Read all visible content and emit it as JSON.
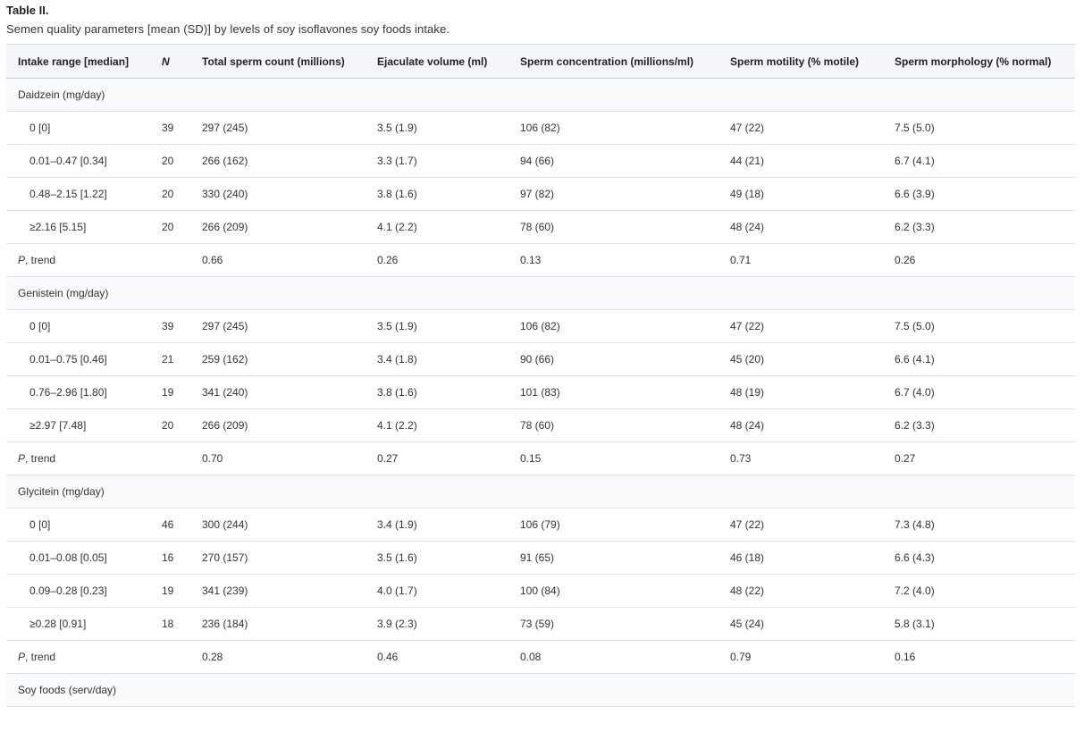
{
  "table_label": "Table II.",
  "caption": "Semen quality parameters [mean (SD)] by levels of soy isoflavones soy foods intake.",
  "columns": [
    "Intake range [median]",
    "N",
    "Total sperm count (millions)",
    "Ejaculate volume (ml)",
    "Sperm concentration (millions/ml)",
    "Sperm motility (% motile)",
    "Sperm morphology (% normal)"
  ],
  "groups": [
    {
      "label": "Daidzein (mg/day)",
      "rows": [
        [
          "0 [0]",
          "39",
          "297 (245)",
          "3.5 (1.9)",
          "106 (82)",
          "47 (22)",
          "7.5 (5.0)"
        ],
        [
          "0.01–0.47 [0.34]",
          "20",
          "266 (162)",
          "3.3 (1.7)",
          "94 (66)",
          "44 (21)",
          "6.7 (4.1)"
        ],
        [
          "0.48–2.15 [1.22]",
          "20",
          "330 (240)",
          "3.8 (1.6)",
          "97 (82)",
          "49 (18)",
          "6.6 (3.9)"
        ],
        [
          "≥2.16 [5.15]",
          "20",
          "266 (209)",
          "4.1 (2.2)",
          "78 (60)",
          "48 (24)",
          "6.2 (3.3)"
        ]
      ],
      "trend": {
        "p": "P",
        "label": ", trend",
        "values": [
          "0.66",
          "0.26",
          "0.13",
          "0.71",
          "0.26"
        ]
      }
    },
    {
      "label": "Genistein (mg/day)",
      "rows": [
        [
          "0 [0]",
          "39",
          "297 (245)",
          "3.5 (1.9)",
          "106 (82)",
          "47 (22)",
          "7.5 (5.0)"
        ],
        [
          "0.01–0.75 [0.46]",
          "21",
          "259 (162)",
          "3.4 (1.8)",
          "90 (66)",
          "45 (20)",
          "6.6 (4.1)"
        ],
        [
          "0.76–2.96 [1.80]",
          "19",
          "341 (240)",
          "3.8 (1.6)",
          "101 (83)",
          "48 (19)",
          "6.7 (4.0)"
        ],
        [
          "≥2.97 [7.48]",
          "20",
          "266 (209)",
          "4.1 (2.2)",
          "78 (60)",
          "48 (24)",
          "6.2 (3.3)"
        ]
      ],
      "trend": {
        "p": "P",
        "label": ", trend",
        "values": [
          "0.70",
          "0.27",
          "0.15",
          "0.73",
          "0.27"
        ]
      }
    },
    {
      "label": "Glycitein (mg/day)",
      "rows": [
        [
          "0 [0]",
          "46",
          "300 (244)",
          "3.4 (1.9)",
          "106 (79)",
          "47 (22)",
          "7.3 (4.8)"
        ],
        [
          "0.01–0.08 [0.05]",
          "16",
          "270 (157)",
          "3.5 (1.6)",
          "91 (65)",
          "46 (18)",
          "6.6 (4.3)"
        ],
        [
          "0.09–0.28 [0.23]",
          "19",
          "341 (239)",
          "4.0 (1.7)",
          "100 (84)",
          "48 (22)",
          "7.2 (4.0)"
        ],
        [
          "≥0.28 [0.91]",
          "18",
          "236 (184)",
          "3.9 (2.3)",
          "73 (59)",
          "45 (24)",
          "5.8 (3.1)"
        ]
      ],
      "trend": {
        "p": "P",
        "label": ", trend",
        "values": [
          "0.28",
          "0.46",
          "0.08",
          "0.79",
          "0.16"
        ]
      }
    },
    {
      "label": "Soy foods (serv/day)",
      "rows": [],
      "trend": null
    }
  ]
}
